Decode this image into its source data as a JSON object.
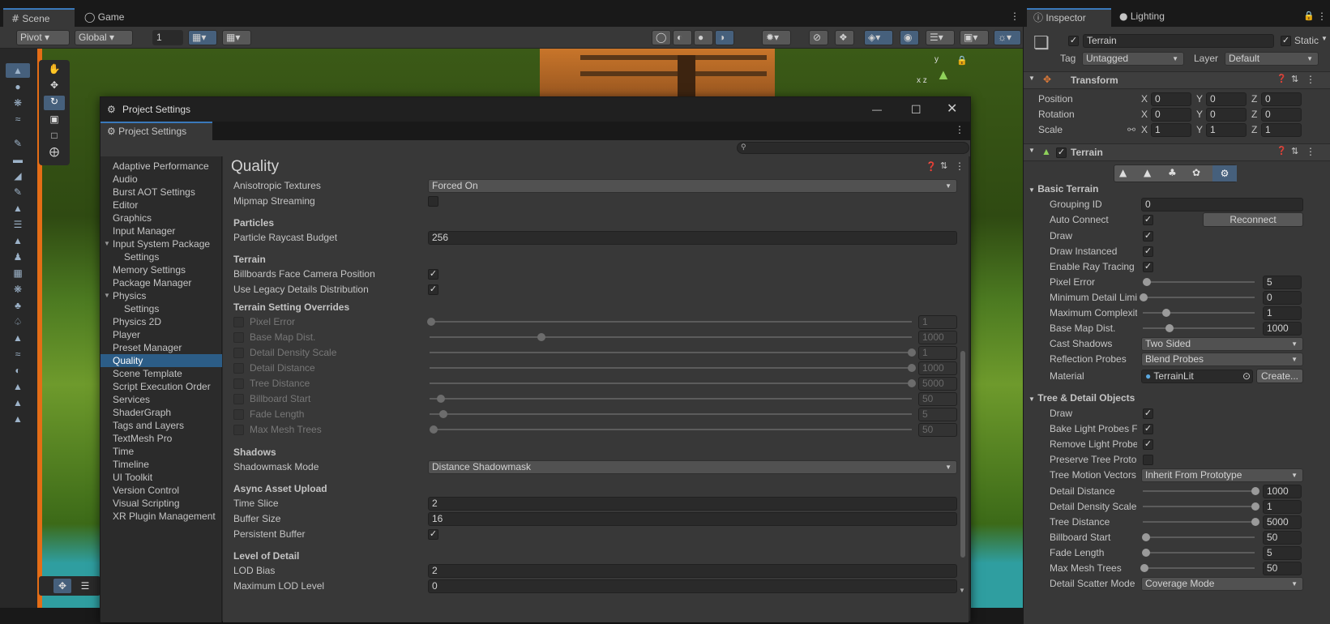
{
  "tabs": {
    "scene": "Scene",
    "game": "Game"
  },
  "toolbar": {
    "pivot": "Pivot",
    "global": "Global",
    "grid_value": "1"
  },
  "project_settings": {
    "window_title": "Project Settings",
    "tab_label": "Project Settings",
    "nav": [
      {
        "label": "Adaptive Performance"
      },
      {
        "label": "Audio"
      },
      {
        "label": "Burst AOT Settings"
      },
      {
        "label": "Editor"
      },
      {
        "label": "Graphics"
      },
      {
        "label": "Input Manager"
      },
      {
        "label": "Input System Package"
      },
      {
        "label": "Settings"
      },
      {
        "label": "Memory Settings"
      },
      {
        "label": "Package Manager"
      },
      {
        "label": "Physics"
      },
      {
        "label": "Settings"
      },
      {
        "label": "Physics 2D"
      },
      {
        "label": "Player"
      },
      {
        "label": "Preset Manager"
      },
      {
        "label": "Quality"
      },
      {
        "label": "Scene Template"
      },
      {
        "label": "Script Execution Order"
      },
      {
        "label": "Services"
      },
      {
        "label": "ShaderGraph"
      },
      {
        "label": "Tags and Layers"
      },
      {
        "label": "TextMesh Pro"
      },
      {
        "label": "Time"
      },
      {
        "label": "Timeline"
      },
      {
        "label": "UI Toolkit"
      },
      {
        "label": "Version Control"
      },
      {
        "label": "Visual Scripting"
      },
      {
        "label": "XR Plugin Management"
      }
    ],
    "page_title": "Quality",
    "anisotropic_label": "Anisotropic Textures",
    "anisotropic_value": "Forced On",
    "mipmap_label": "Mipmap Streaming",
    "particles_header": "Particles",
    "particle_budget_label": "Particle Raycast Budget",
    "particle_budget_value": "256",
    "terrain_header": "Terrain",
    "billboards_label": "Billboards Face Camera Position",
    "legacy_details_label": "Use Legacy Details Distribution",
    "overrides_header": "Terrain Setting Overrides",
    "overrides": [
      {
        "label": "Pixel Error",
        "value": "1",
        "fraction": 0.0
      },
      {
        "label": "Base Map Dist.",
        "value": "1000",
        "fraction": 0.23
      },
      {
        "label": "Detail Density Scale",
        "value": "1",
        "fraction": 1.0
      },
      {
        "label": "Detail Distance",
        "value": "1000",
        "fraction": 1.0
      },
      {
        "label": "Tree Distance",
        "value": "5000",
        "fraction": 1.0
      },
      {
        "label": "Billboard Start",
        "value": "50",
        "fraction": 0.02
      },
      {
        "label": "Fade Length",
        "value": "5",
        "fraction": 0.025
      },
      {
        "label": "Max Mesh Trees",
        "value": "50",
        "fraction": 0.005
      }
    ],
    "shadows_header": "Shadows",
    "shadowmask_label": "Shadowmask Mode",
    "shadowmask_value": "Distance Shadowmask",
    "async_header": "Async Asset Upload",
    "time_slice_label": "Time Slice",
    "time_slice_value": "2",
    "buffer_size_label": "Buffer Size",
    "buffer_size_value": "16",
    "persistent_label": "Persistent Buffer",
    "lod_header": "Level of Detail",
    "lod_bias_label": "LOD Bias",
    "lod_bias_value": "2",
    "max_lod_label": "Maximum LOD Level",
    "max_lod_value": "0"
  },
  "inspector": {
    "tab_inspector": "Inspector",
    "tab_lighting": "Lighting",
    "object_name": "Terrain",
    "static_label": "Static",
    "tag_label": "Tag",
    "tag_value": "Untagged",
    "layer_label": "Layer",
    "layer_value": "Default",
    "transform_title": "Transform",
    "position_label": "Position",
    "rotation_label": "Rotation",
    "scale_label": "Scale",
    "axis_x": "X",
    "axis_y": "Y",
    "axis_z": "Z",
    "position": {
      "x": "0",
      "y": "0",
      "z": "0"
    },
    "rotation": {
      "x": "0",
      "y": "0",
      "z": "0"
    },
    "scale": {
      "x": "1",
      "y": "1",
      "z": "1"
    },
    "terrain_title": "Terrain",
    "basic_terrain_header": "Basic Terrain",
    "grouping_id_label": "Grouping ID",
    "grouping_id_value": "0",
    "auto_connect_label": "Auto Connect",
    "reconnect_label": "Reconnect",
    "draw_label": "Draw",
    "draw_instanced_label": "Draw Instanced",
    "ray_tracing_label": "Enable Ray Tracing S",
    "pixel_error_label": "Pixel Error",
    "pixel_error_value": "5",
    "pixel_error_fraction": 0.03,
    "min_detail_label": "Minimum Detail Limi",
    "min_detail_value": "0",
    "min_detail_fraction": 0.0,
    "max_complexity_label": "Maximum Complexit",
    "max_complexity_value": "1",
    "max_complexity_fraction": 0.2,
    "base_map_label": "Base Map Dist.",
    "base_map_value": "1000",
    "base_map_fraction": 0.23,
    "cast_shadows_label": "Cast Shadows",
    "cast_shadows_value": "Two Sided",
    "reflection_label": "Reflection Probes",
    "reflection_value": "Blend Probes",
    "material_label": "Material",
    "material_value": "TerrainLit",
    "create_label": "Create...",
    "tree_header": "Tree & Detail Objects",
    "tree_draw_label": "Draw",
    "bake_light_label": "Bake Light Probes F",
    "remove_light_label": "Remove Light Probe",
    "preserve_tree_label": "Preserve Tree Proto",
    "tree_motion_label": "Tree Motion Vectors",
    "tree_motion_value": "Inherit From Prototype",
    "detail_distance_label": "Detail Distance",
    "detail_distance_value": "1000",
    "detail_distance_fraction": 1.0,
    "detail_density_label": "Detail Density Scale",
    "detail_density_value": "1",
    "detail_density_fraction": 1.0,
    "tree_distance_label": "Tree Distance",
    "tree_distance_value": "5000",
    "tree_distance_fraction": 1.0,
    "billboard_start_label": "Billboard Start",
    "billboard_start_value": "50",
    "billboard_start_fraction": 0.02,
    "fade_length_label": "Fade Length",
    "fade_length_value": "5",
    "fade_length_fraction": 0.025,
    "max_mesh_label": "Max Mesh Trees",
    "max_mesh_value": "50",
    "max_mesh_fraction": 0.005,
    "scatter_label": "Detail Scatter Mode",
    "scatter_value": "Coverage Mode"
  }
}
